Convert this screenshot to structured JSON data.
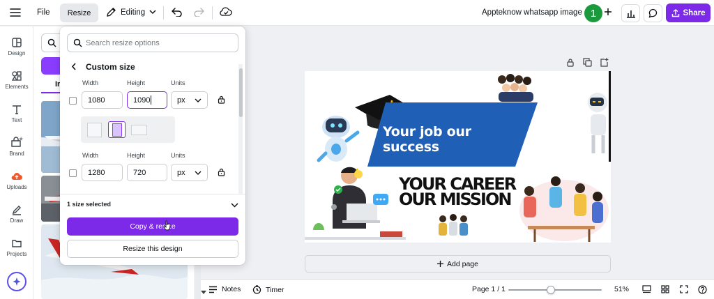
{
  "topbar": {
    "file_label": "File",
    "resize_label": "Resize",
    "editing_label": "Editing",
    "doc_title": "Appteknow whatsapp image",
    "avatar_initial": "1",
    "share_label": "Share"
  },
  "rail": {
    "items": [
      {
        "label": "Design",
        "icon": "design-icon"
      },
      {
        "label": "Elements",
        "icon": "elements-icon"
      },
      {
        "label": "Text",
        "icon": "text-icon"
      },
      {
        "label": "Brand",
        "icon": "brand-icon"
      },
      {
        "label": "Uploads",
        "icon": "uploads-icon"
      },
      {
        "label": "Draw",
        "icon": "draw-icon"
      },
      {
        "label": "Projects",
        "icon": "projects-icon"
      }
    ]
  },
  "sidepanel": {
    "tab_label": "Ir"
  },
  "resize_popover": {
    "search_placeholder": "Search resize options",
    "section_title": "Custom size",
    "width_label": "Width",
    "height_label": "Height",
    "units_label": "Units",
    "row1": {
      "width": "1080",
      "height": "1090",
      "unit": "px"
    },
    "row2": {
      "width": "1280",
      "height": "720",
      "unit": "px"
    },
    "selected_count": "1 size selected",
    "copy_resize_label": "Copy & resize",
    "resize_design_label": "Resize this design"
  },
  "canvas": {
    "headline": "Your job our success",
    "tagline_1": "YOUR CAREER",
    "tagline_2": "OUR MISSION",
    "add_page_label": "Add page"
  },
  "bottombar": {
    "notes_label": "Notes",
    "timer_label": "Timer",
    "page_label": "Page 1 / 1",
    "zoom_label": "51%",
    "zoom_value": 51
  },
  "colors": {
    "accent": "#7d2ae8",
    "avatar_green": "#1b9a3d",
    "banner_blue": "#1f5fb5"
  }
}
